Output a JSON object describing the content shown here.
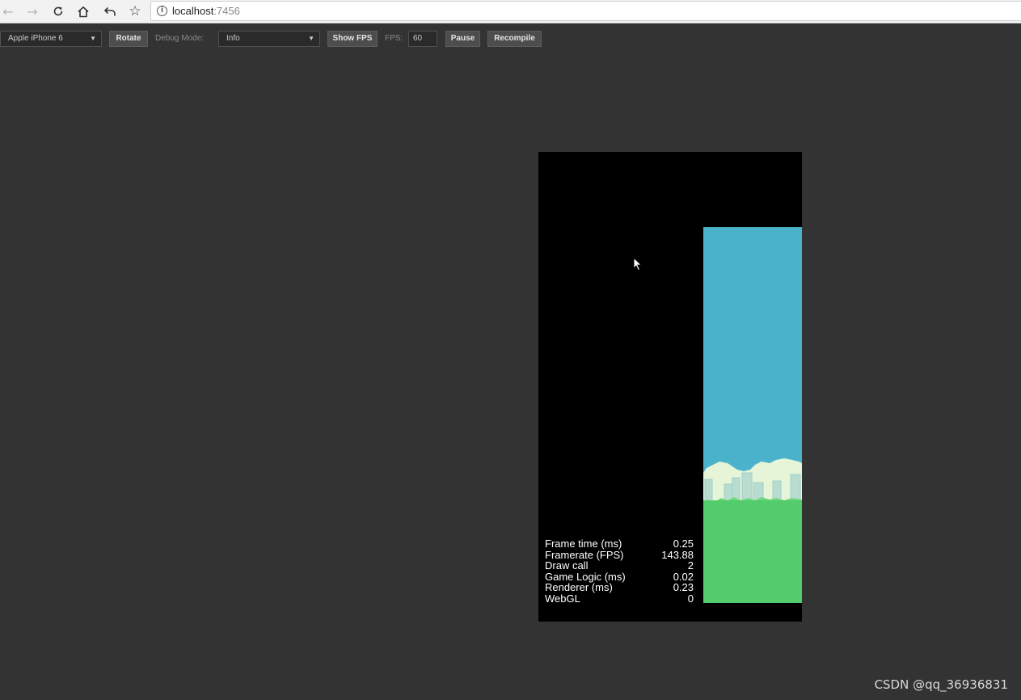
{
  "browser": {
    "back_icon": "arrow-left-icon",
    "forward_icon": "arrow-right-icon",
    "reload_icon": "reload-icon",
    "home_icon": "home-icon",
    "undo_icon": "undo-icon",
    "bookmark_icon": "star-icon",
    "url_host": "localhost",
    "url_port": ":7456"
  },
  "toolbar": {
    "device_select": "Apple iPhone 6",
    "rotate_label": "Rotate",
    "debug_mode_label": "Debug Mode:",
    "debug_mode_value": "Info",
    "show_fps_label": "Show FPS",
    "fps_label": "FPS:",
    "fps_value": "60",
    "pause_label": "Pause",
    "recompile_label": "Recompile"
  },
  "stats": [
    {
      "label": "Frame time (ms)",
      "value": "0.25"
    },
    {
      "label": "Framerate (FPS)",
      "value": "143.88"
    },
    {
      "label": "Draw call",
      "value": "2"
    },
    {
      "label": "Game Logic (ms)",
      "value": "0.02"
    },
    {
      "label": "Renderer (ms)",
      "value": "0.23"
    },
    {
      "label": "WebGL",
      "value": "0"
    }
  ],
  "colors": {
    "page_bg": "#333333",
    "sky": "#4ab3cb",
    "ground": "#54cc6b",
    "canvas_bg": "#000000"
  },
  "watermark": "CSDN @qq_36936831"
}
